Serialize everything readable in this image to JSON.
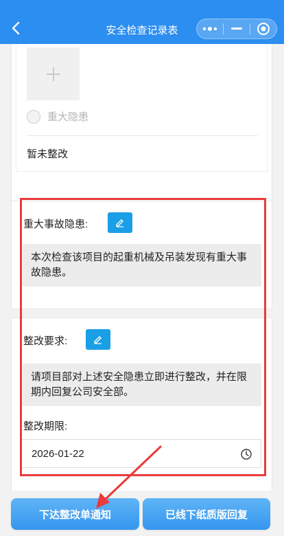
{
  "header": {
    "title": "安全检查记录表",
    "back_icon": "chevron-left-icon",
    "capsule_icons": [
      "more-dots-icon",
      "minimize-icon",
      "target-icon"
    ],
    "bg_color": "#2b8ef0"
  },
  "top_card": {
    "upload_icon": "plus-icon",
    "checkbox_label": "重大隐患",
    "status_text": "暂未整改"
  },
  "hazard_section": {
    "label": "重大事故隐患:",
    "edit_icon": "pencil-icon",
    "text": "本次检查该项目的起重机械及吊装发现有重大事故隐患。"
  },
  "rectify_section": {
    "requirement_label": "整改要求:",
    "edit_icon": "pencil-icon",
    "requirement_text": "请项目部对上述安全隐患立即进行整改，并在限期内回复公司安全部。",
    "deadline_label": "整改期限:",
    "deadline_value": "2026-01-22",
    "clock_icon": "clock-icon"
  },
  "actions": {
    "left_label": "下达整改单通知",
    "right_label": "已线下纸质版回复",
    "button_color": "#3596ee"
  },
  "annotation_color": "#ea3a3a"
}
